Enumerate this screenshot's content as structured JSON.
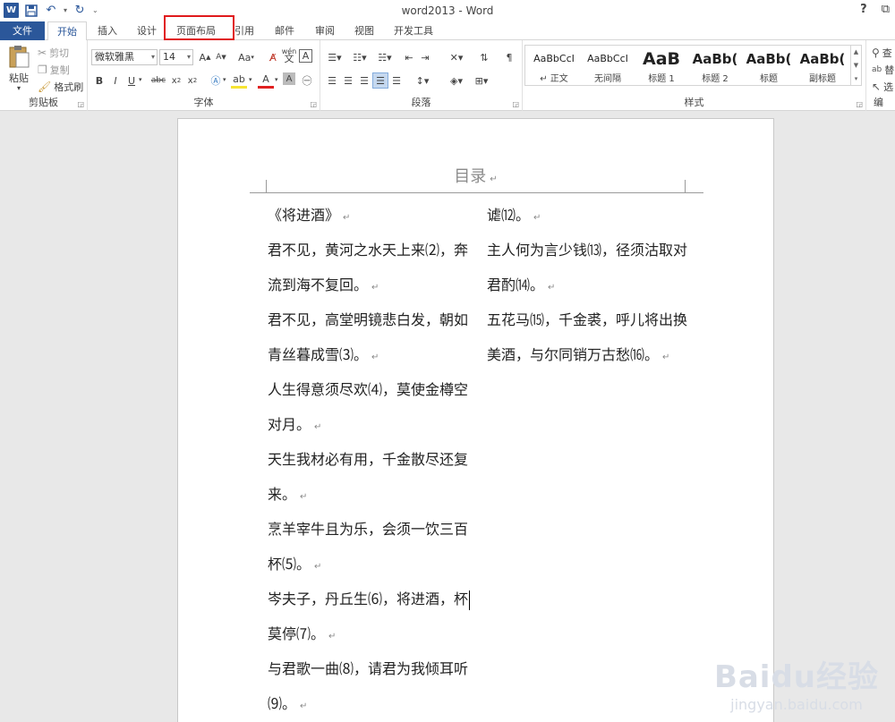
{
  "window": {
    "title": "word2013 - Word",
    "help": "?",
    "restore": "▭"
  },
  "qat": {
    "logo_letter": "W",
    "save_icon": "save-icon",
    "undo_icon": "undo-icon",
    "redo_icon": "redo-icon",
    "customize": "⌄"
  },
  "tabs": [
    {
      "label": "文件"
    },
    {
      "label": "开始"
    },
    {
      "label": "插入"
    },
    {
      "label": "设计"
    },
    {
      "label": "页面布局"
    },
    {
      "label": "引用"
    },
    {
      "label": "邮件"
    },
    {
      "label": "审阅"
    },
    {
      "label": "视图"
    },
    {
      "label": "开发工具"
    }
  ],
  "ribbon": {
    "clipboard": {
      "paste": "粘贴",
      "cut": "剪切",
      "copy": "复制",
      "format_painter": "格式刷",
      "label": "剪贴板"
    },
    "font": {
      "name": "微软雅黑",
      "size": "14",
      "grow": "A",
      "shrink": "A",
      "case": "Aa",
      "label": "字体",
      "phonetic": "wén"
    },
    "paragraph": {
      "label": "段落"
    },
    "styles": {
      "label": "样式",
      "items": [
        {
          "sample": "AaBbCcI",
          "name": "↵ 正文"
        },
        {
          "sample": "AaBbCcI",
          "name": "无间隔"
        },
        {
          "sample": "AaB",
          "name": "标题 1"
        },
        {
          "sample": "AaBb(",
          "name": "标题 2"
        },
        {
          "sample": "AaBb(",
          "name": "标题"
        },
        {
          "sample": "AaBb(",
          "name": "副标题"
        }
      ]
    },
    "editing": {
      "label": "编",
      "find": "查",
      "replace": "替",
      "select": "选"
    }
  },
  "document": {
    "header_title": "目录",
    "left_column": [
      "《将进酒》",
      "君不见，黄河之水天上来⑵，奔",
      "流到海不复回。",
      "君不见，高堂明镜悲白发，朝如",
      "青丝暮成雪⑶。",
      "人生得意须尽欢⑷，莫使金樽空",
      "对月。",
      "天生我材必有用，千金散尽还复",
      "来。",
      "烹羊宰牛且为乐，会须一饮三百",
      "杯⑸。",
      "岑夫子，丹丘生⑹，将进酒，杯",
      "莫停⑺。",
      "与君歌一曲⑻，请君为我倾耳听",
      "⑼。"
    ],
    "right_column": [
      "谑⑿。",
      "主人何为言少钱⒀，径须沽取对",
      "君酌⒁。",
      "五花马⒂，千金裘，呼儿将出换",
      "美酒，与尔同销万古愁⒃。"
    ],
    "paragraph_mark": "↵"
  },
  "watermark": {
    "main": "Baidu经验",
    "sub": "jingyan.baidu.com"
  }
}
